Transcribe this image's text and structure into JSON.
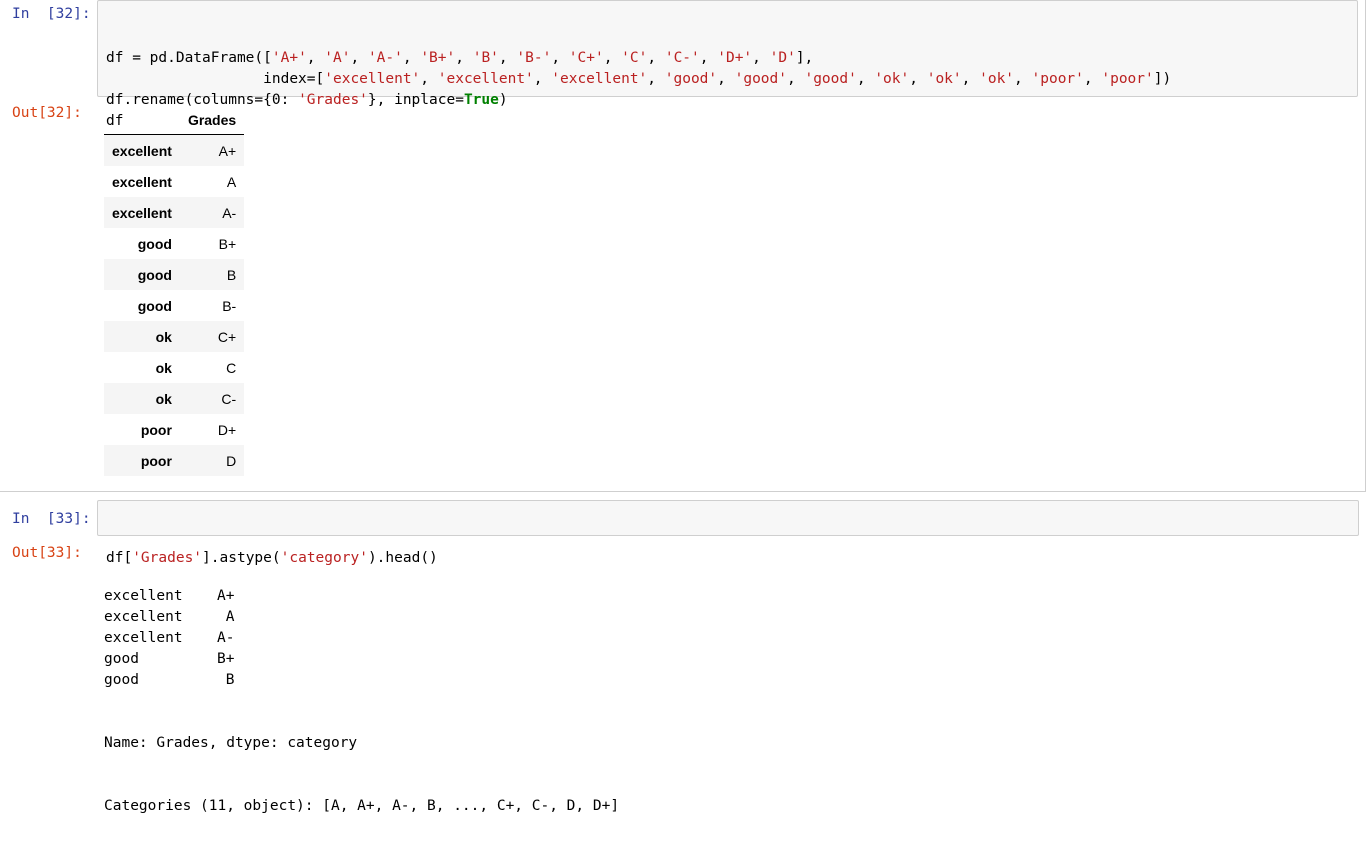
{
  "cell32": {
    "prompt_in": "In  [32]:",
    "prompt_out": "Out[32]:",
    "code": [
      [
        {
          "t": "df = pd.DataFrame([",
          "c": "op"
        },
        {
          "t": "'A+'",
          "c": "str"
        },
        {
          "t": ", ",
          "c": "op"
        },
        {
          "t": "'A'",
          "c": "str"
        },
        {
          "t": ", ",
          "c": "op"
        },
        {
          "t": "'A-'",
          "c": "str"
        },
        {
          "t": ", ",
          "c": "op"
        },
        {
          "t": "'B+'",
          "c": "str"
        },
        {
          "t": ", ",
          "c": "op"
        },
        {
          "t": "'B'",
          "c": "str"
        },
        {
          "t": ", ",
          "c": "op"
        },
        {
          "t": "'B-'",
          "c": "str"
        },
        {
          "t": ", ",
          "c": "op"
        },
        {
          "t": "'C+'",
          "c": "str"
        },
        {
          "t": ", ",
          "c": "op"
        },
        {
          "t": "'C'",
          "c": "str"
        },
        {
          "t": ", ",
          "c": "op"
        },
        {
          "t": "'C-'",
          "c": "str"
        },
        {
          "t": ", ",
          "c": "op"
        },
        {
          "t": "'D+'",
          "c": "str"
        },
        {
          "t": ", ",
          "c": "op"
        },
        {
          "t": "'D'",
          "c": "str"
        },
        {
          "t": "],",
          "c": "op"
        }
      ],
      [
        {
          "t": "                  index=[",
          "c": "op"
        },
        {
          "t": "'excellent'",
          "c": "str"
        },
        {
          "t": ", ",
          "c": "op"
        },
        {
          "t": "'excellent'",
          "c": "str"
        },
        {
          "t": ", ",
          "c": "op"
        },
        {
          "t": "'excellent'",
          "c": "str"
        },
        {
          "t": ", ",
          "c": "op"
        },
        {
          "t": "'good'",
          "c": "str"
        },
        {
          "t": ", ",
          "c": "op"
        },
        {
          "t": "'good'",
          "c": "str"
        },
        {
          "t": ", ",
          "c": "op"
        },
        {
          "t": "'good'",
          "c": "str"
        },
        {
          "t": ", ",
          "c": "op"
        },
        {
          "t": "'ok'",
          "c": "str"
        },
        {
          "t": ", ",
          "c": "op"
        },
        {
          "t": "'ok'",
          "c": "str"
        },
        {
          "t": ", ",
          "c": "op"
        },
        {
          "t": "'ok'",
          "c": "str"
        },
        {
          "t": ", ",
          "c": "op"
        },
        {
          "t": "'poor'",
          "c": "str"
        },
        {
          "t": ", ",
          "c": "op"
        },
        {
          "t": "'poor'",
          "c": "str"
        },
        {
          "t": "])",
          "c": "op"
        }
      ],
      [
        {
          "t": "df.rename(columns={0: ",
          "c": "op"
        },
        {
          "t": "'Grades'",
          "c": "str"
        },
        {
          "t": "}, inplace=",
          "c": "op"
        },
        {
          "t": "True",
          "c": "kw"
        },
        {
          "t": ")",
          "c": "op"
        }
      ],
      [
        {
          "t": "df",
          "c": "op"
        }
      ]
    ],
    "table": {
      "column": "Grades",
      "rows": [
        {
          "index": "excellent",
          "value": "A+"
        },
        {
          "index": "excellent",
          "value": "A"
        },
        {
          "index": "excellent",
          "value": "A-"
        },
        {
          "index": "good",
          "value": "B+"
        },
        {
          "index": "good",
          "value": "B"
        },
        {
          "index": "good",
          "value": "B-"
        },
        {
          "index": "ok",
          "value": "C+"
        },
        {
          "index": "ok",
          "value": "C"
        },
        {
          "index": "ok",
          "value": "C-"
        },
        {
          "index": "poor",
          "value": "D+"
        },
        {
          "index": "poor",
          "value": "D"
        }
      ]
    }
  },
  "cell33": {
    "prompt_in": "In  [33]:",
    "prompt_out": "Out[33]:",
    "code": [
      [
        {
          "t": "df[",
          "c": "op"
        },
        {
          "t": "'Grades'",
          "c": "str"
        },
        {
          "t": "].astype(",
          "c": "op"
        },
        {
          "t": "'category'",
          "c": "str"
        },
        {
          "t": ").head()",
          "c": "op"
        }
      ]
    ],
    "series": [
      {
        "index": "excellent",
        "value": "A+"
      },
      {
        "index": "excellent",
        "value": " A"
      },
      {
        "index": "excellent",
        "value": "A-"
      },
      {
        "index": "good",
        "value": "B+"
      },
      {
        "index": "good",
        "value": " B"
      }
    ],
    "name_line": "Name: Grades, dtype: category",
    "categories_line": "Categories (11, object): [A, A+, A-, B, ..., C+, C-, D, D+]"
  }
}
